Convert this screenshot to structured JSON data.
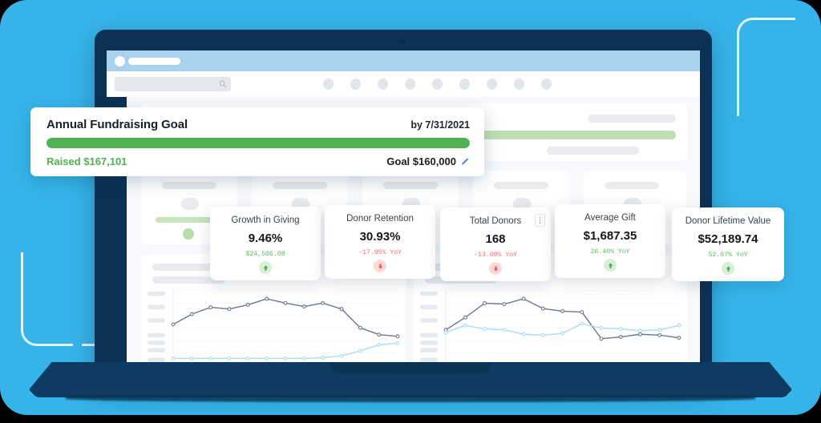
{
  "goal_card": {
    "title": "Annual Fundraising Goal",
    "date_label": "by 7/31/2021",
    "raised_label": "Raised $167,101",
    "target_label": "Goal $160,000",
    "progress_percent": 100,
    "bar_color": "#4fb14f",
    "edit_icon": "pencil-icon"
  },
  "metrics": [
    {
      "title": "Growth in Giving",
      "value": "9.46%",
      "sub": "$24,506.08",
      "direction": "up",
      "arrow_icon": "arrow-up-icon",
      "has_menu": false
    },
    {
      "title": "Donor Retention",
      "value": "30.93%",
      "sub": "-17.95% YoY",
      "direction": "down",
      "arrow_icon": "arrow-down-icon",
      "has_menu": false
    },
    {
      "title": "Total Donors",
      "value": "168",
      "sub": "-13.00% YoY",
      "direction": "down",
      "arrow_icon": "arrow-down-icon",
      "has_menu": true,
      "menu_icon": "kebab-menu-icon"
    },
    {
      "title": "Average Gift",
      "value": "$1,687.35",
      "sub": "26.40% YoY",
      "direction": "up",
      "arrow_icon": "arrow-up-icon",
      "has_menu": false
    },
    {
      "title": "Donor Lifetime Value",
      "value": "$52,189.74",
      "sub": "52.07% YoY",
      "direction": "up",
      "arrow_icon": "arrow-up-icon",
      "has_menu": false
    }
  ],
  "browser": {
    "search_icon": "search-icon",
    "nav_dot_count": 9
  },
  "colors": {
    "backdrop_blue": "#36b4ea",
    "laptop_navy": "#0b3255",
    "accent_green": "#4fb14f",
    "accent_red": "#f2726f",
    "line_dark": "#6f7594",
    "line_light": "#a9dcf5"
  },
  "chart_data": [
    {
      "type": "line",
      "title": "",
      "xlabel": "",
      "ylabel": "",
      "grid": true,
      "legend_position": "bottom",
      "x": [
        0,
        1,
        2,
        3,
        4,
        5,
        6,
        7,
        8,
        9,
        10,
        11,
        12
      ],
      "series": [
        {
          "name": "series-dark",
          "color": "#6f7594",
          "values": [
            48,
            60,
            68,
            66,
            71,
            78,
            73,
            69,
            73,
            66,
            44,
            36,
            34
          ]
        },
        {
          "name": "series-light",
          "color": "#a9dcf5",
          "values": [
            8,
            8,
            8,
            8,
            8,
            8,
            8,
            8,
            9,
            11,
            17,
            24,
            26
          ]
        }
      ]
    },
    {
      "type": "line",
      "title": "",
      "xlabel": "",
      "ylabel": "",
      "grid": true,
      "legend_position": "bottom",
      "x": [
        0,
        1,
        2,
        3,
        4,
        5,
        6,
        7,
        8,
        9,
        10,
        11,
        12
      ],
      "series": [
        {
          "name": "series-dark",
          "color": "#6f7594",
          "values": [
            40,
            54,
            70,
            69,
            75,
            64,
            61,
            60,
            30,
            32,
            35,
            34,
            31
          ]
        },
        {
          "name": "series-light",
          "color": "#a9dcf5",
          "values": [
            37,
            45,
            41,
            40,
            35,
            34,
            36,
            47,
            42,
            41,
            39,
            40,
            45
          ]
        }
      ]
    }
  ]
}
